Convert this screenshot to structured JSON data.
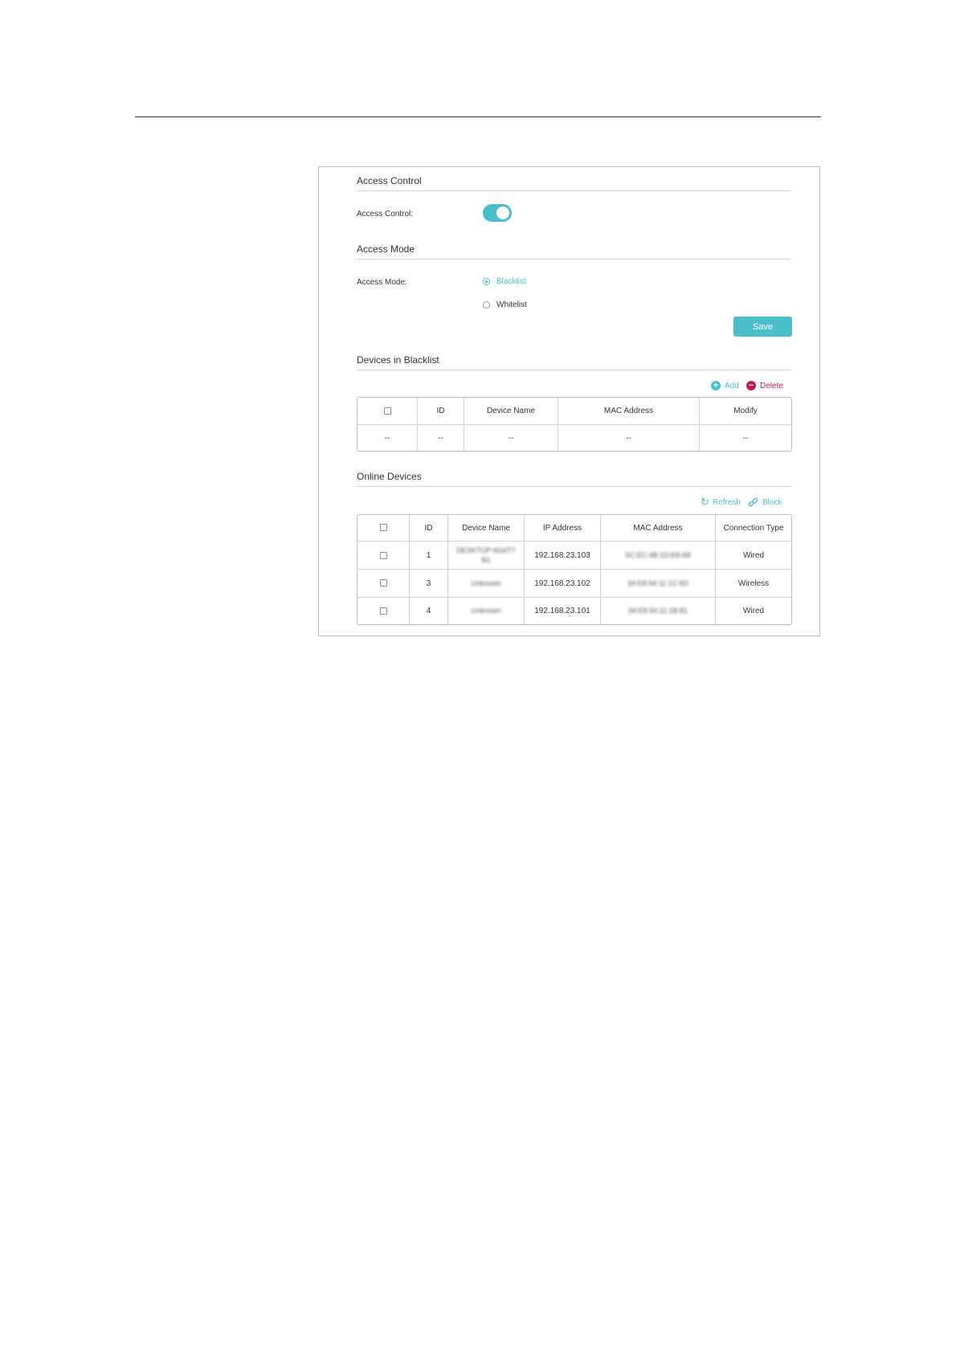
{
  "access_control_section": {
    "title": "Access Control",
    "label": "Access Control:",
    "enabled": true
  },
  "access_mode_section": {
    "title": "Access Mode",
    "label": "Access Mode:",
    "options": [
      {
        "label": "Blacklist",
        "selected": true
      },
      {
        "label": "Whitelist",
        "selected": false
      }
    ],
    "save_label": "Save"
  },
  "blacklist": {
    "title": "Devices in Blacklist",
    "add_label": "Add",
    "delete_label": "Delete",
    "columns": [
      "ID",
      "Device Name",
      "MAC Address",
      "Modify"
    ],
    "rows": [
      {
        "checkbox": "--",
        "id": "--",
        "name": "--",
        "mac": "--",
        "modify": "--"
      }
    ]
  },
  "online": {
    "title": "Online Devices",
    "refresh_label": "Refresh",
    "block_label": "Block",
    "columns": [
      "ID",
      "Device Name",
      "IP Address",
      "MAC Address",
      "Connection Type"
    ],
    "rows": [
      {
        "id": "1",
        "name": "DESKTOP-6G6T7 B1",
        "ip": "192.168.23.103",
        "mac": "5C:EC:4B:1D:E8:A8",
        "type": "Wired"
      },
      {
        "id": "3",
        "name": "Unknown",
        "ip": "192.168.23.102",
        "mac": "34:E8:94:11:1C:6D",
        "type": "Wireless"
      },
      {
        "id": "4",
        "name": "Unknown",
        "ip": "192.168.23.101",
        "mac": "34:E8:94:11:1B:81",
        "type": "Wired"
      }
    ]
  },
  "colors": {
    "accent": "#4bbfc9",
    "delete": "#c2185b"
  },
  "icons": {
    "add": "plus-circle-icon",
    "delete": "minus-circle-icon",
    "refresh": "refresh-icon",
    "block": "link-icon"
  }
}
